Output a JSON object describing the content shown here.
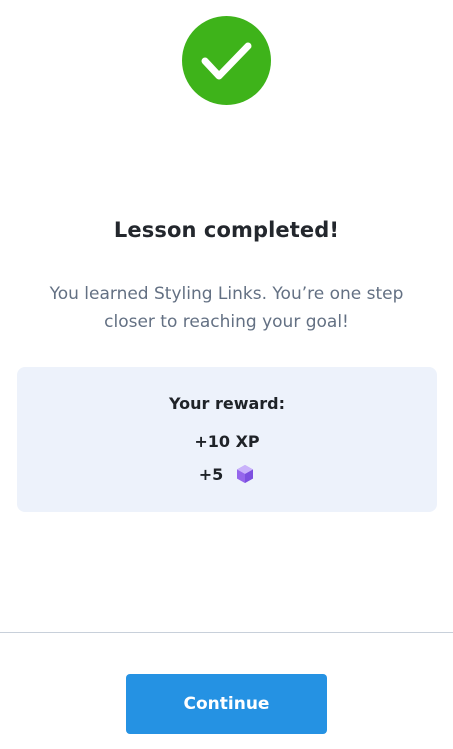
{
  "completion": {
    "icon": "checkmark-icon",
    "icon_color": "#3eb31a",
    "title": "Lesson completed!",
    "message": "You learned Styling Links. You’re one step closer to reaching your goal!"
  },
  "reward": {
    "heading": "Your reward:",
    "xp": "+10 XP",
    "gems": "+5",
    "gem_icon": "gem-icon",
    "card_color": "#edf2fb"
  },
  "footer": {
    "continue_label": "Continue",
    "button_color": "#2592e3"
  }
}
